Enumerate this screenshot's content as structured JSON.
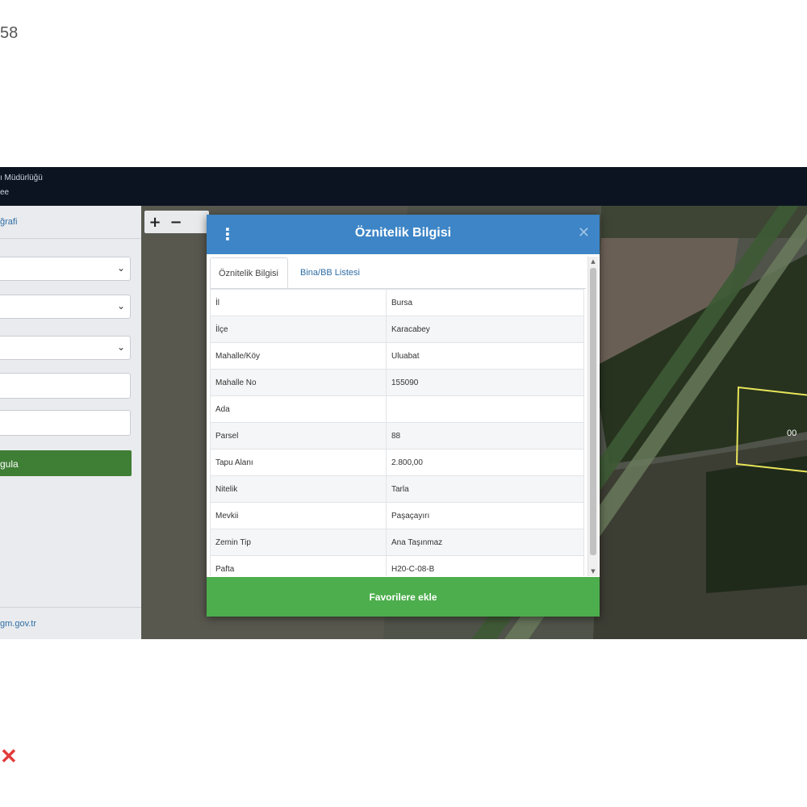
{
  "corner": {
    "number": "58",
    "mark": "✕"
  },
  "header": {
    "line1": "ı Müdürlüğü",
    "line2": "ee"
  },
  "sidebar": {
    "top_link": "ğrafi",
    "search_button": "gula",
    "footer_link": "gm.gov.tr"
  },
  "map": {
    "zoom_in": "+",
    "zoom_out": "−",
    "parcel_label": "00"
  },
  "dialog": {
    "title": "Öznitelik Bilgisi",
    "menu_icon": "⋮",
    "close_icon": "✕",
    "tabs": [
      {
        "label": "Öznitelik Bilgisi",
        "active": true
      },
      {
        "label": "Bina/BB Listesi",
        "active": false
      }
    ],
    "rows": [
      {
        "key": "İl",
        "value": "Bursa"
      },
      {
        "key": "İlçe",
        "value": "Karacabey"
      },
      {
        "key": "Mahalle/Köy",
        "value": "Uluabat"
      },
      {
        "key": "Mahalle No",
        "value": "155090"
      },
      {
        "key": "Ada",
        "value": ""
      },
      {
        "key": "Parsel",
        "value": "88"
      },
      {
        "key": "Tapu Alanı",
        "value": "2.800,00"
      },
      {
        "key": "Nitelik",
        "value": "Tarla"
      },
      {
        "key": "Mevkii",
        "value": "Paşaçayırı"
      },
      {
        "key": "Zemin Tip",
        "value": "Ana Taşınmaz"
      },
      {
        "key": "Pafta",
        "value": "H20-C-08-B"
      }
    ],
    "favorite_button": "Favorilere ekle"
  },
  "colors": {
    "dialog_header": "#3d85c6",
    "favorite_button": "#4cae4c",
    "sidebar_button": "#3f7e35",
    "topbar": "#0c1422",
    "parcel_outline": "#e8e55a"
  }
}
